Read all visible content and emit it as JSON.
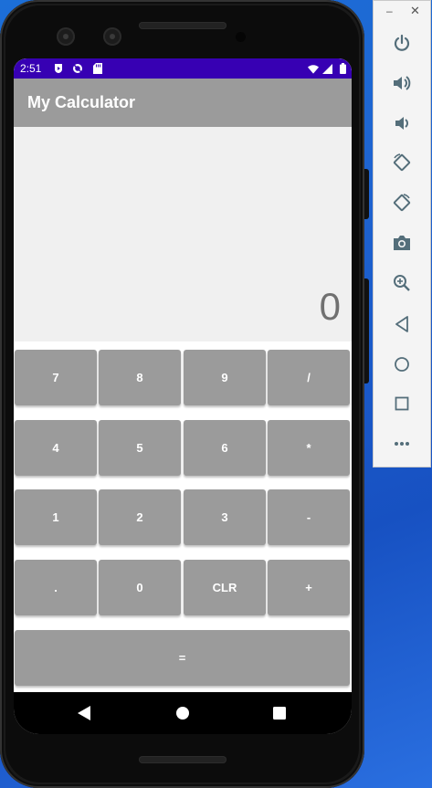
{
  "status_bar": {
    "time": "2:51",
    "icons": [
      "play-protect-icon",
      "no-sync-icon",
      "sd-card-icon",
      "wifi-icon",
      "signal-icon",
      "battery-icon"
    ]
  },
  "app": {
    "title": "My Calculator",
    "display_value": "0"
  },
  "keypad": {
    "rows": [
      [
        "7",
        "8",
        "9",
        "/"
      ],
      [
        "4",
        "5",
        "6",
        "*"
      ],
      [
        "1",
        "2",
        "3",
        "-"
      ],
      [
        ".",
        "0",
        "CLR",
        "+"
      ]
    ],
    "equals": "="
  },
  "navigation_bar": [
    "back-icon",
    "home-icon",
    "recents-icon"
  ],
  "emulator_toolbar": {
    "window_controls": {
      "minimize": "–",
      "close": "✕"
    },
    "buttons": [
      "power-icon",
      "volume-up-icon",
      "volume-down-icon",
      "rotate-left-icon",
      "rotate-right-icon",
      "camera-icon",
      "zoom-icon",
      "back-icon",
      "home-icon",
      "overview-icon",
      "more-icon"
    ]
  },
  "colors": {
    "status_bar": "#3700b3",
    "app_bar": "#9b9b9b",
    "key": "#9b9b9b",
    "display_bg": "#f0f0f0",
    "display_text": "#707070",
    "desktop": "#1e63d0"
  }
}
